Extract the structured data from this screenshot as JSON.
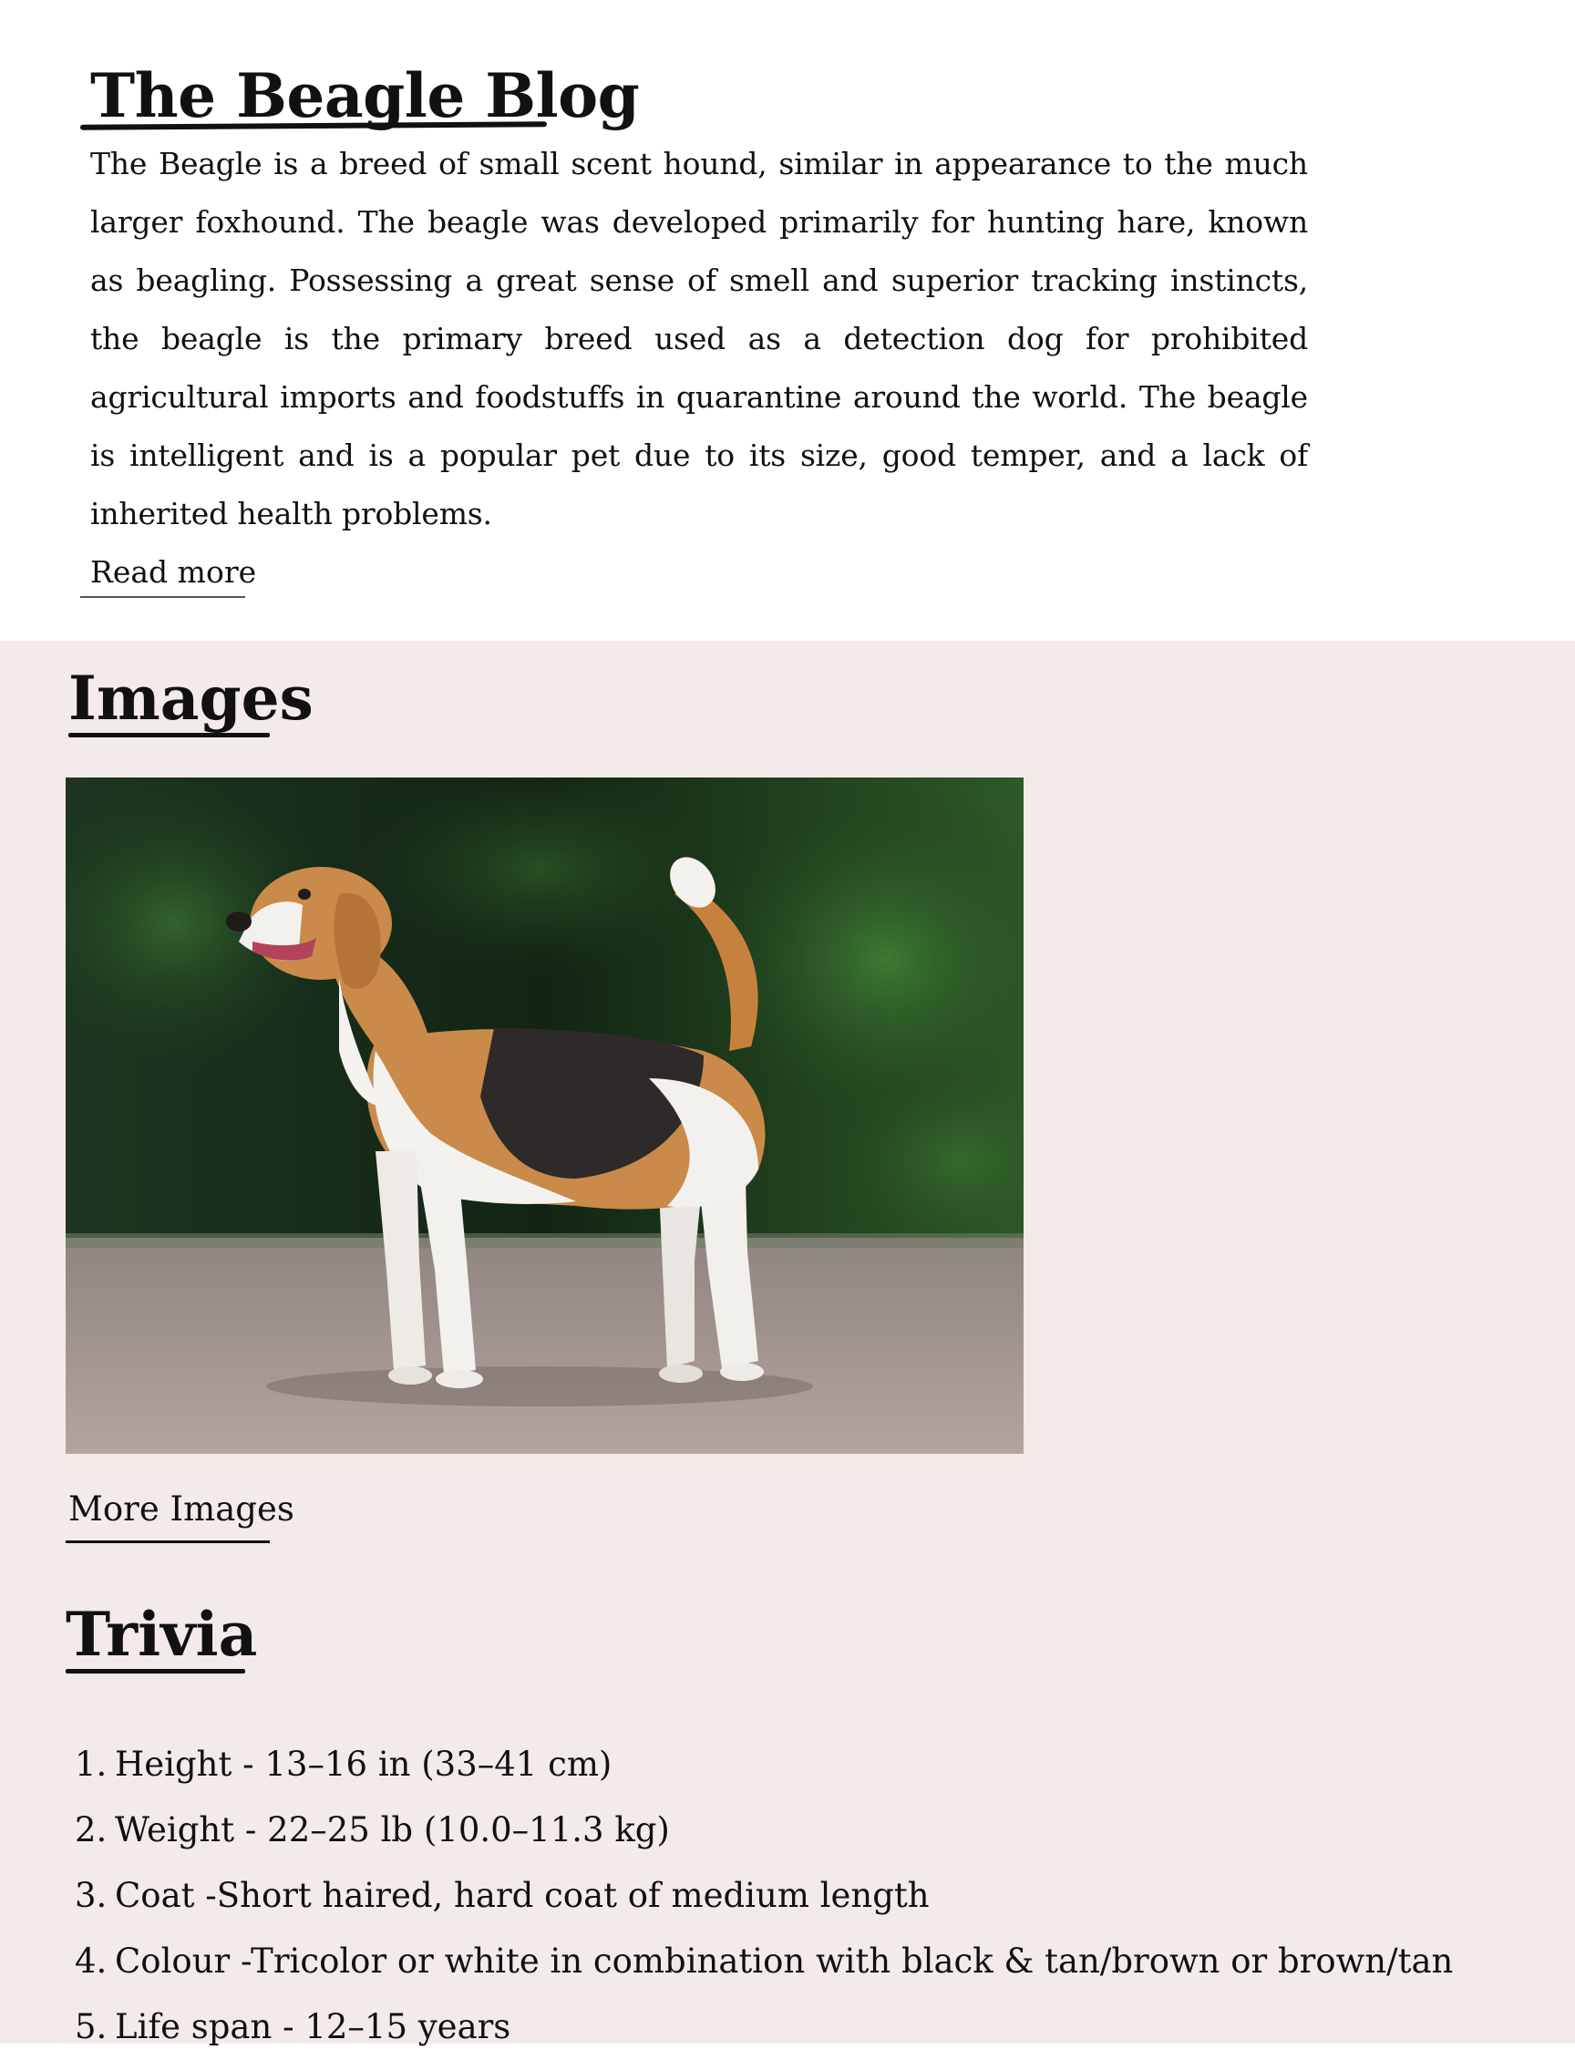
{
  "blog": {
    "title": "The Beagle Blog",
    "intro": "The Beagle is a breed of small scent hound, similar in appearance to the much larger foxhound. The beagle was developed primarily for hunting hare, known as beagling. Possessing a great sense of smell and superior tracking instincts, the beagle is the primary breed used as a detection dog for prohibited agricultural imports and foodstuffs in quarantine around the world. The beagle is intelligent and is a popular pet due to its size, good temper, and a lack of inherited health problems.",
    "read_more": "Read more"
  },
  "images": {
    "heading": "Images",
    "photo_subject": "beagle-photo",
    "more_link": "More Images"
  },
  "trivia": {
    "heading": "Trivia",
    "items": [
      {
        "num": "1.",
        "text": "Height - 13–16 in (33–41 cm)"
      },
      {
        "num": "2.",
        "text": "Weight - 22–25 lb (10.0–11.3 kg)"
      },
      {
        "num": "3.",
        "text": "Coat -Short haired, hard coat of medium length"
      },
      {
        "num": "4.",
        "text": "Colour -Tricolor or white in combination with black & tan/brown or brown/tan"
      },
      {
        "num": "5.",
        "text": "Life span - 12–15 years"
      }
    ]
  },
  "colors": {
    "page_background": "#ffffff",
    "section_background": "#f3eaea",
    "text": "#111111"
  }
}
